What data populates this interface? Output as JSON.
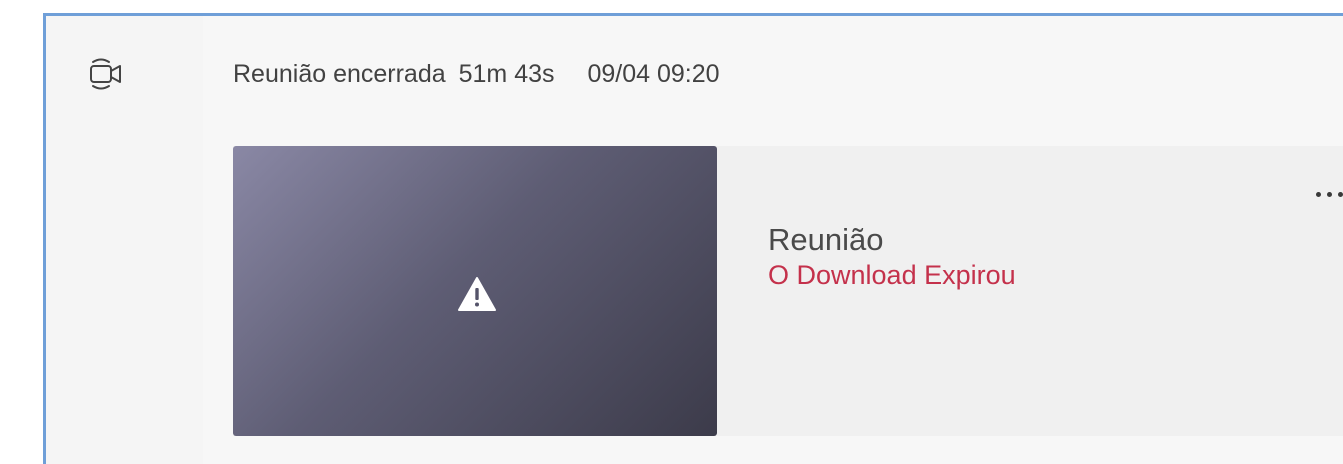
{
  "event": {
    "status_label": "Reunião encerrada",
    "duration": "51m 43s",
    "datetime": "09/04 09:20"
  },
  "recording": {
    "title": "Reunião",
    "status": "O Download Expirou",
    "status_color": "#c4314b",
    "thumbnail_icon": "warning-icon",
    "more_icon": "more-options-icon"
  },
  "icons": {
    "rail": "meeting-camera-icon"
  }
}
